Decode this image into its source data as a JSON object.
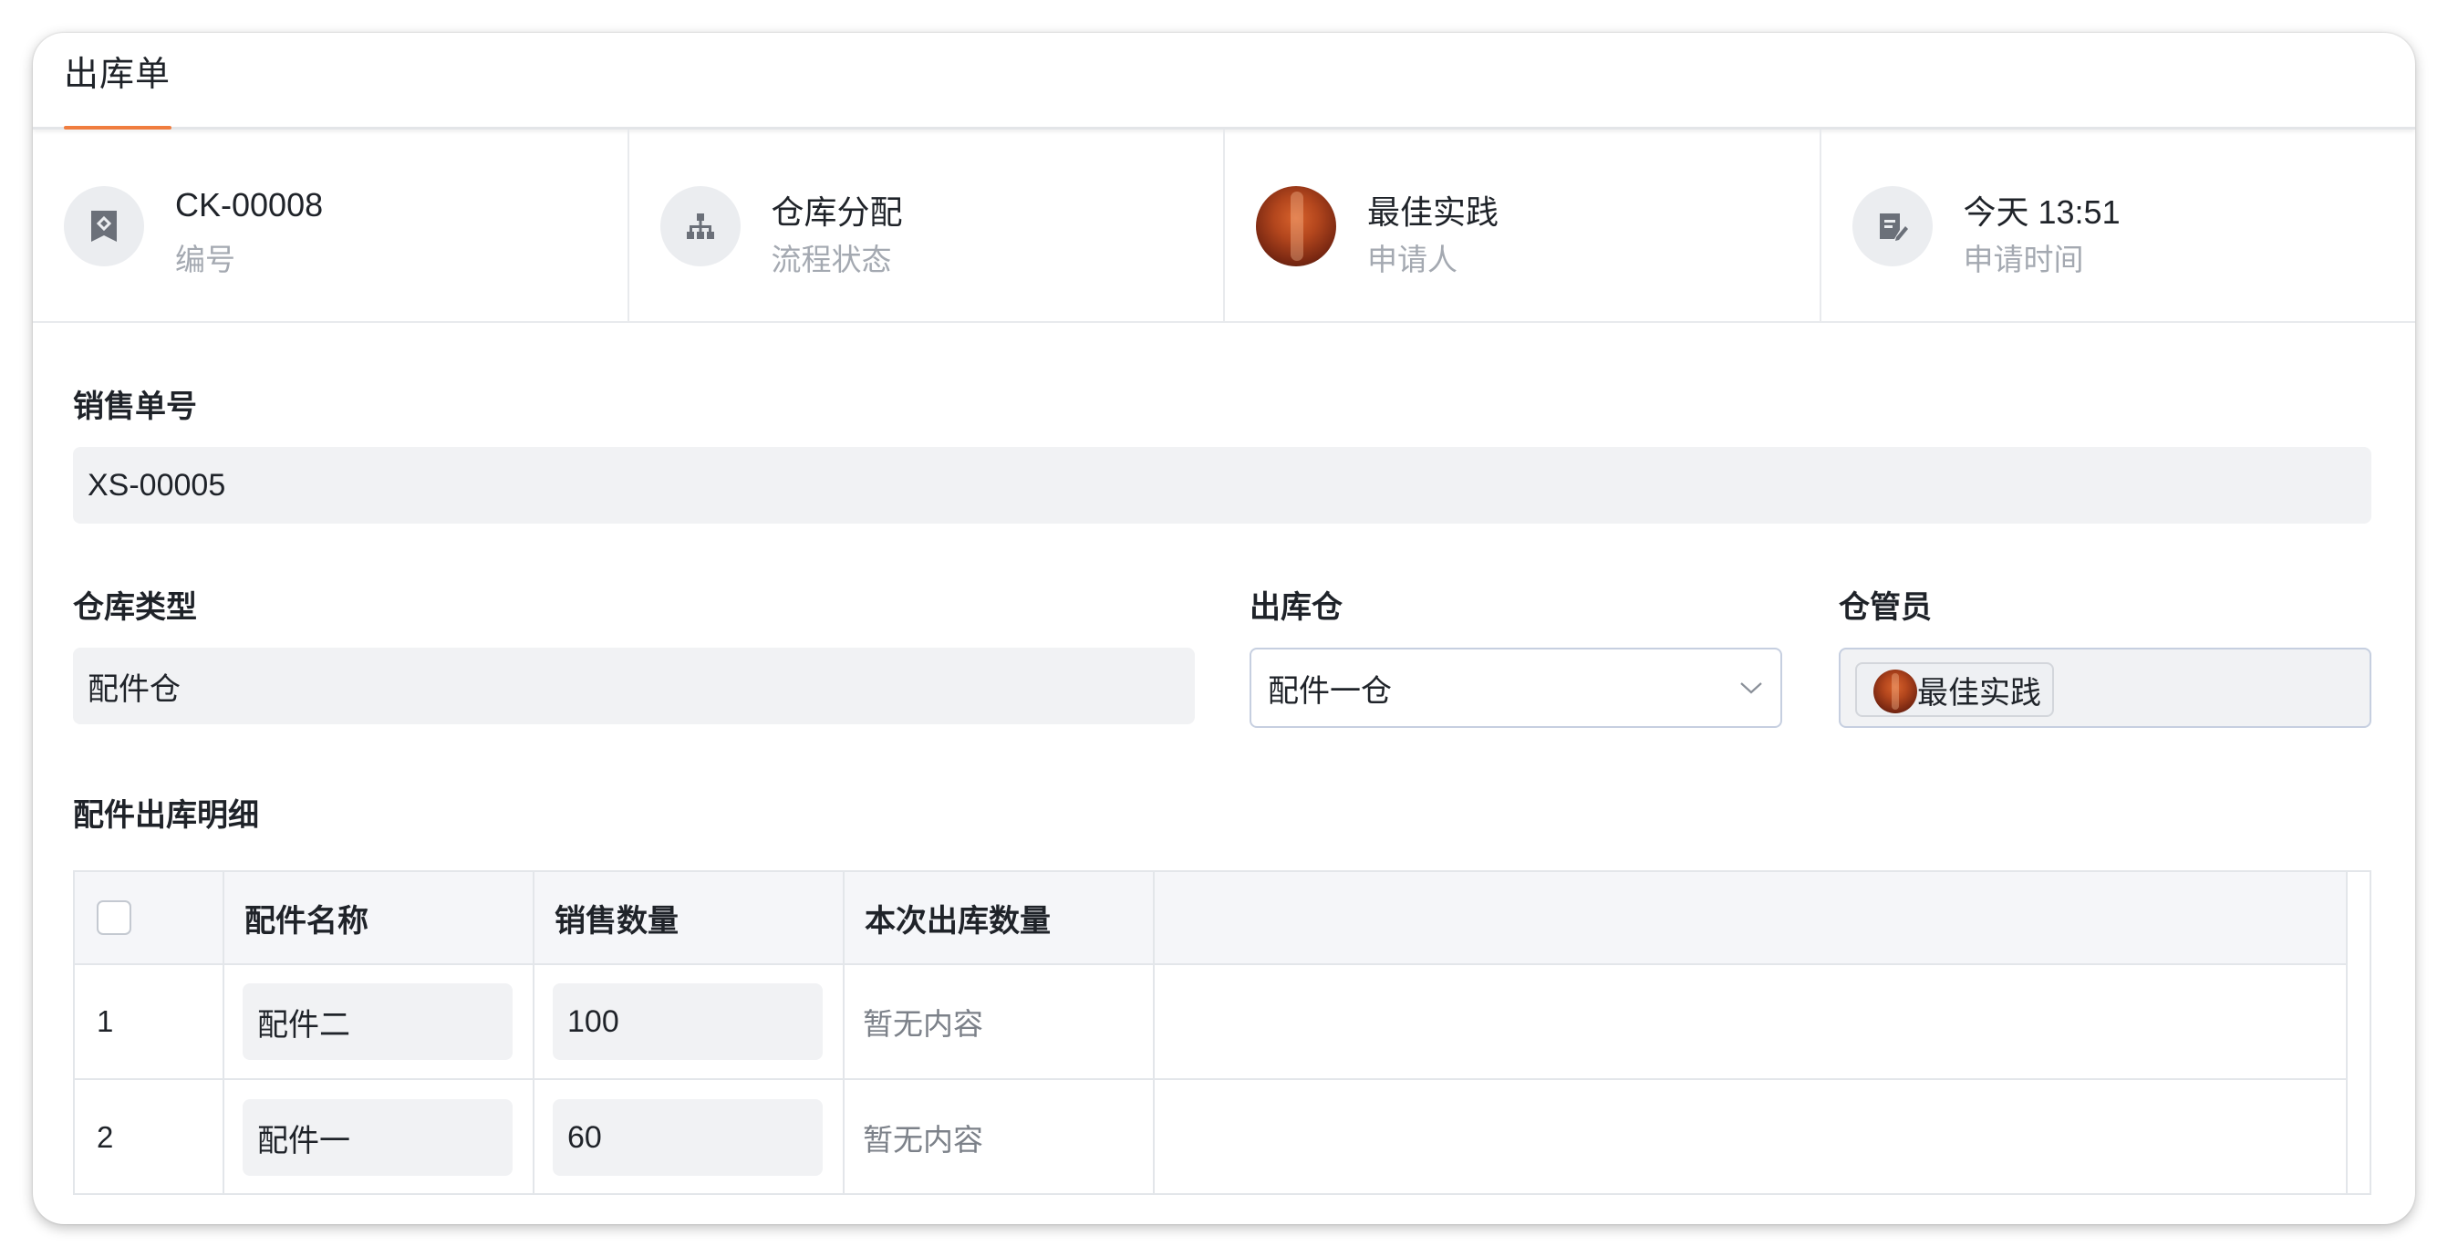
{
  "header": {
    "title": "出库单"
  },
  "info": [
    {
      "value": "CK-00008",
      "label": "编号",
      "icon": "bookmark-icon"
    },
    {
      "value": "仓库分配",
      "label": "流程状态",
      "icon": "org-tree-icon"
    },
    {
      "value": "最佳实践",
      "label": "申请人",
      "icon": "avatar"
    },
    {
      "value": "今天 13:51",
      "label": "申请时间",
      "icon": "edit-doc-icon"
    }
  ],
  "form": {
    "sales_no": {
      "label": "销售单号",
      "value": "XS-00005"
    },
    "warehouse_type": {
      "label": "仓库类型",
      "value": "配件仓"
    },
    "out_warehouse": {
      "label": "出库仓",
      "value": "配件一仓"
    },
    "keeper": {
      "label": "仓管员",
      "value": "最佳实践"
    }
  },
  "detail": {
    "title": "配件出库明细",
    "columns": [
      "配件名称",
      "销售数量",
      "本次出库数量"
    ],
    "rows": [
      {
        "index": "1",
        "name": "配件二",
        "qty": "100",
        "out_qty": "暂无内容"
      },
      {
        "index": "2",
        "name": "配件一",
        "qty": "60",
        "out_qty": "暂无内容"
      }
    ]
  },
  "colors": {
    "accent": "#f07d3f",
    "border": "#e3e6ea",
    "readonly_bg": "#f1f2f4",
    "muted_text": "#a4a9b1"
  }
}
